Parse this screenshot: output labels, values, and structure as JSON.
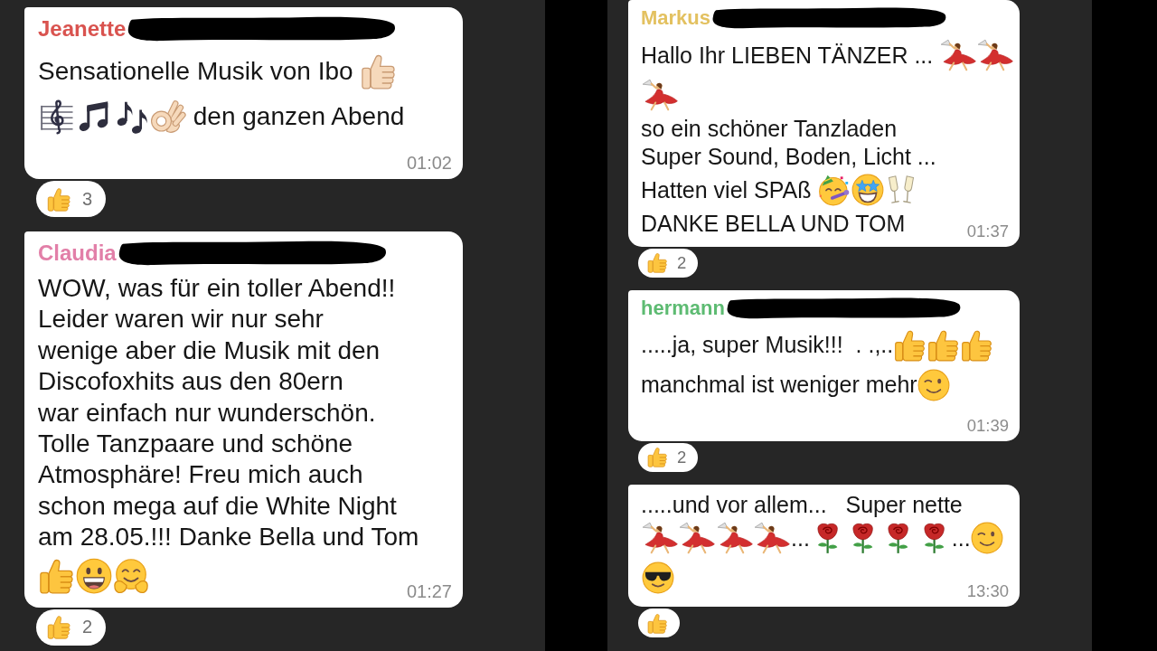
{
  "panels": [
    {
      "messages": [
        {
          "sender": {
            "name": "Jeanette",
            "color": "#d9534f",
            "redacted": true
          },
          "lines": [
            [
              {
                "kind": "text",
                "text": "Sensationelle Musik von Ibo "
              },
              {
                "kind": "thumbsup",
                "light_skin": true
              }
            ],
            [
              {
                "kind": "staff"
              },
              {
                "kind": "beamednotes"
              },
              {
                "kind": "eighthnotes"
              },
              {
                "kind": "okhand",
                "light_skin": true
              },
              {
                "kind": "text",
                "text": " den ganzen Abend"
              }
            ]
          ],
          "time": "01:02",
          "reaction": {
            "kind": "thumbsup",
            "count": "3"
          }
        },
        {
          "sender": {
            "name": "Claudia",
            "color": "#e27fa8",
            "redacted": true
          },
          "lines": [
            [
              {
                "kind": "text",
                "text": "WOW, was für ein toller Abend!!\nLeider waren wir nur sehr\nwenige aber die Musik mit den\nDiscofoxhits aus den 80ern\nwar einfach nur wunderschön.\nTolle Tanzpaare und schöne\nAtmosphäre! Freu mich auch\nschon mega auf die White Night\nam 28.05.!!! Danke Bella und Tom"
              }
            ],
            [
              {
                "kind": "thumbsup"
              },
              {
                "kind": "grinning"
              },
              {
                "kind": "hugging"
              }
            ]
          ],
          "time": "01:27",
          "reaction": {
            "kind": "thumbsup",
            "count": "2"
          }
        }
      ]
    },
    {
      "messages": [
        {
          "sender": {
            "name": "Markus",
            "color": "#e3c160",
            "redacted": true
          },
          "lines": [
            [
              {
                "kind": "text",
                "text": "Hallo Ihr LIEBEN TÄNZER ... "
              },
              {
                "kind": "dancer"
              },
              {
                "kind": "dancer"
              }
            ],
            [
              {
                "kind": "dancer"
              }
            ],
            [
              {
                "kind": "text",
                "text": "so ein schöner Tanzladen\nSuper Sound, Boden, Licht ..."
              }
            ],
            [
              {
                "kind": "text",
                "text": "Hatten viel SPAß "
              },
              {
                "kind": "partyface"
              },
              {
                "kind": "starstruck"
              },
              {
                "kind": "glasses"
              }
            ],
            [
              {
                "kind": "text",
                "text": "DANKE BELLA UND TOM"
              }
            ]
          ],
          "time": "01:37",
          "reaction": {
            "kind": "thumbsup",
            "count": "2"
          }
        },
        {
          "sender": {
            "name": "hermann",
            "color": "#5dbb72",
            "redacted": true
          },
          "lines": [
            [
              {
                "kind": "text",
                "text": ".....ja, super Musik!!!  . .,.."
              },
              {
                "kind": "thumbsup"
              },
              {
                "kind": "thumbsup"
              },
              {
                "kind": "thumbsup"
              }
            ],
            [
              {
                "kind": "text",
                "text": "manchmal ist weniger mehr"
              },
              {
                "kind": "winking"
              }
            ]
          ],
          "time": "01:39",
          "reaction": {
            "kind": "thumbsup",
            "count": "2"
          }
        },
        {
          "lines": [
            [
              {
                "kind": "text",
                "text": ".....und vor allem...   Super nette"
              }
            ],
            [
              {
                "kind": "dancer"
              },
              {
                "kind": "dancer"
              },
              {
                "kind": "dancer"
              },
              {
                "kind": "dancer"
              },
              {
                "kind": "text",
                "text": "..."
              },
              {
                "kind": "rose"
              },
              {
                "kind": "rose"
              },
              {
                "kind": "rose"
              },
              {
                "kind": "rose"
              },
              {
                "kind": "text",
                "text": "..."
              },
              {
                "kind": "winking"
              }
            ],
            [
              {
                "kind": "sunglasses"
              }
            ]
          ],
          "time": "13:30",
          "reaction": {
            "kind": "thumbsup"
          }
        }
      ]
    }
  ]
}
